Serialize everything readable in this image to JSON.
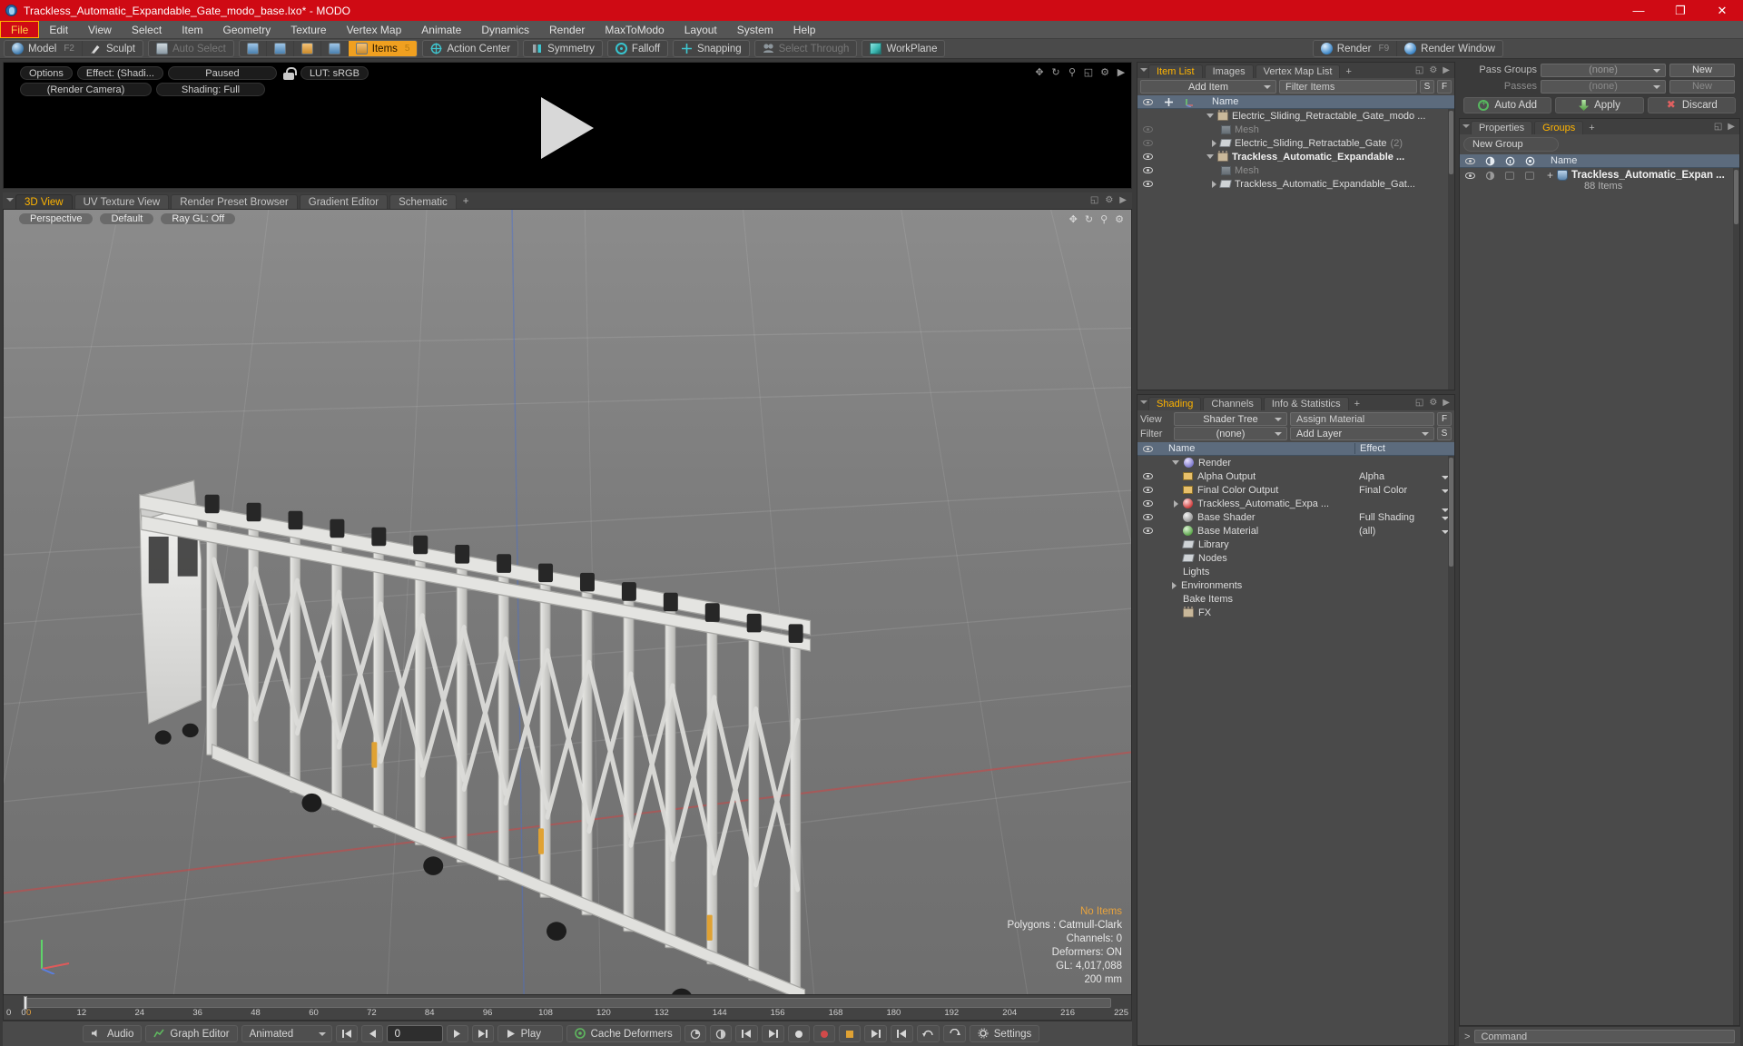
{
  "window": {
    "title": "Trackless_Automatic_Expandable_Gate_modo_base.lxo* - MODO",
    "app_icon": "modo-icon",
    "minimize": "—",
    "maximize": "❐",
    "close": "✕"
  },
  "menu": {
    "items": [
      "File",
      "Edit",
      "View",
      "Select",
      "Item",
      "Geometry",
      "Texture",
      "Vertex Map",
      "Animate",
      "Dynamics",
      "Render",
      "MaxToModo",
      "Layout",
      "System",
      "Help"
    ],
    "active": "File"
  },
  "toolbar": {
    "mode_model": "Model",
    "mode_model_hotkey": "F2",
    "mode_sculpt": "Sculpt",
    "auto_select": "Auto Select",
    "items": "Items",
    "items_hotkey": "5",
    "action_center": "Action Center",
    "symmetry": "Symmetry",
    "falloff": "Falloff",
    "snapping": "Snapping",
    "select_through": "Select Through",
    "workplane": "WorkPlane",
    "render": "Render",
    "render_hotkey": "F9",
    "render_window": "Render Window"
  },
  "preview": {
    "options": "Options",
    "effect": "Effect: (Shadi...",
    "status": "Paused",
    "lock_icon": "unlock-icon",
    "lut": "LUT: sRGB",
    "camera": "(Render Camera)",
    "shading": "Shading: Full"
  },
  "viewport_tabs": {
    "tabs": [
      "3D View",
      "UV Texture View",
      "Render Preset Browser",
      "Gradient Editor",
      "Schematic"
    ],
    "active": "3D View",
    "add": "+"
  },
  "viewport": {
    "projection": "Perspective",
    "style": "Default",
    "raygl": "Ray GL: Off",
    "stats": {
      "selection": "No Items",
      "polygons": "Polygons : Catmull-Clark",
      "channels": "Channels: 0",
      "deformers": "Deformers: ON",
      "gl": "GL: 4,017,088",
      "scale": "200 mm"
    }
  },
  "timeline": {
    "start": "0",
    "end": "225",
    "ticks": [
      "0",
      "12",
      "24",
      "36",
      "48",
      "60",
      "72",
      "84",
      "96",
      "108",
      "120",
      "132",
      "144",
      "156",
      "168",
      "180",
      "192",
      "204",
      "216"
    ],
    "range_start": "0",
    "range_end": "225"
  },
  "transport": {
    "audio": "Audio",
    "graph_editor": "Graph Editor",
    "animated": "Animated",
    "frame": "0",
    "play": "Play",
    "cache_deformers": "Cache Deformers",
    "settings": "Settings",
    "first_icon": "skip-to-start-icon",
    "prev_icon": "step-back-icon",
    "next_icon": "step-forward-icon",
    "last_icon": "skip-to-end-icon"
  },
  "item_list": {
    "tabs": [
      "Item List",
      "Images",
      "Vertex Map List"
    ],
    "active_tab": "Item List",
    "add": "+",
    "add_item": "Add Item",
    "filter_placeholder": "Filter Items",
    "btn_s": "S",
    "btn_f": "F",
    "columns": [
      "Name"
    ],
    "rows": [
      {
        "name": "Electric_Sliding_Retractable_Gate_modo ...",
        "icon": "scene-icon",
        "indent": 1,
        "expander": "down",
        "eye": "none",
        "bold": false,
        "count": ""
      },
      {
        "name": "Mesh",
        "icon": "mesh-icon",
        "indent": 2,
        "expander": "none",
        "eye": "off",
        "bold": false,
        "dim": true,
        "count": ""
      },
      {
        "name": "Electric_Sliding_Retractable_Gate",
        "icon": "group-icon",
        "indent": 2,
        "expander": "right",
        "eye": "off",
        "bold": false,
        "count": "(2)"
      },
      {
        "name": "Trackless_Automatic_Expandable ...",
        "icon": "scene-icon",
        "indent": 1,
        "expander": "down",
        "eye": "on",
        "bold": true,
        "count": ""
      },
      {
        "name": "Mesh",
        "icon": "mesh-icon",
        "indent": 2,
        "expander": "none",
        "eye": "on",
        "bold": false,
        "dim": true,
        "count": ""
      },
      {
        "name": "Trackless_Automatic_Expandable_Gat...",
        "icon": "group-icon",
        "indent": 2,
        "expander": "right",
        "eye": "on",
        "bold": false,
        "count": ""
      }
    ]
  },
  "shading": {
    "tabs": [
      "Shading",
      "Channels",
      "Info & Statistics"
    ],
    "active_tab": "Shading",
    "add": "+",
    "view_label": "View",
    "view_value": "Shader Tree",
    "assign_material": "Assign Material",
    "btn_f": "F",
    "filter_label": "Filter",
    "filter_value": "(none)",
    "add_layer": "Add Layer",
    "btn_s": "S",
    "columns": [
      "Name",
      "Effect"
    ],
    "rows": [
      {
        "name": "Render",
        "effect": "",
        "icon": "render-globe-icon",
        "indent": 1,
        "expander": "down",
        "eye": "none"
      },
      {
        "name": "Alpha Output",
        "effect": "Alpha",
        "icon": "image-output-icon",
        "indent": 2,
        "expander": "leaf",
        "eye": "on"
      },
      {
        "name": "Final Color Output",
        "effect": "Final Color",
        "icon": "image-output-icon",
        "indent": 2,
        "expander": "leaf",
        "eye": "on"
      },
      {
        "name": "Trackless_Automatic_Expa ...",
        "effect": "",
        "icon": "material-red-icon",
        "indent": 2,
        "expander": "right",
        "eye": "on"
      },
      {
        "name": "Base Shader",
        "effect": "Full Shading",
        "icon": "shader-icon",
        "indent": 2,
        "expander": "leaf",
        "eye": "on"
      },
      {
        "name": "Base Material",
        "effect": "(all)",
        "icon": "material-green-icon",
        "indent": 2,
        "expander": "leaf",
        "eye": "on"
      },
      {
        "name": "Library",
        "effect": "",
        "icon": "folder-icon",
        "indent": 2,
        "expander": "none",
        "eye": "none"
      },
      {
        "name": "Nodes",
        "effect": "",
        "icon": "folder-icon",
        "indent": 2,
        "expander": "none",
        "eye": "none"
      },
      {
        "name": "Lights",
        "effect": "",
        "icon": "none",
        "indent": 2,
        "expander": "none",
        "eye": "none"
      },
      {
        "name": "Environments",
        "effect": "",
        "icon": "none",
        "indent": 2,
        "expander": "right",
        "eye": "none"
      },
      {
        "name": "Bake Items",
        "effect": "",
        "icon": "none",
        "indent": 2,
        "expander": "none",
        "eye": "none"
      },
      {
        "name": "FX",
        "effect": "",
        "icon": "scene-icon",
        "indent": 2,
        "expander": "none",
        "eye": "none"
      }
    ]
  },
  "passes": {
    "pass_groups_label": "Pass Groups",
    "pass_groups_value": "(none)",
    "pass_groups_new": "New",
    "passes_label": "Passes",
    "passes_value": "(none)",
    "passes_new": "New",
    "auto_add": "Auto Add",
    "apply": "Apply",
    "discard": "Discard"
  },
  "groups": {
    "tabs": [
      "Properties",
      "Groups"
    ],
    "active_tab": "Groups",
    "add": "+",
    "new_group": "New Group",
    "columns": [
      "Name"
    ],
    "rows": [
      {
        "name": "Trackless_Automatic_Expan ...",
        "sub": "88 Items",
        "icon": "group-shield-icon"
      }
    ]
  },
  "command": {
    "prompt": ">",
    "placeholder": "Command"
  },
  "colors": {
    "titlebar": "#cf0a14",
    "accent": "#ffb400",
    "selected_button": "#f0a020",
    "panel": "#4a4a4a",
    "listhead": "#5c6b7d"
  }
}
